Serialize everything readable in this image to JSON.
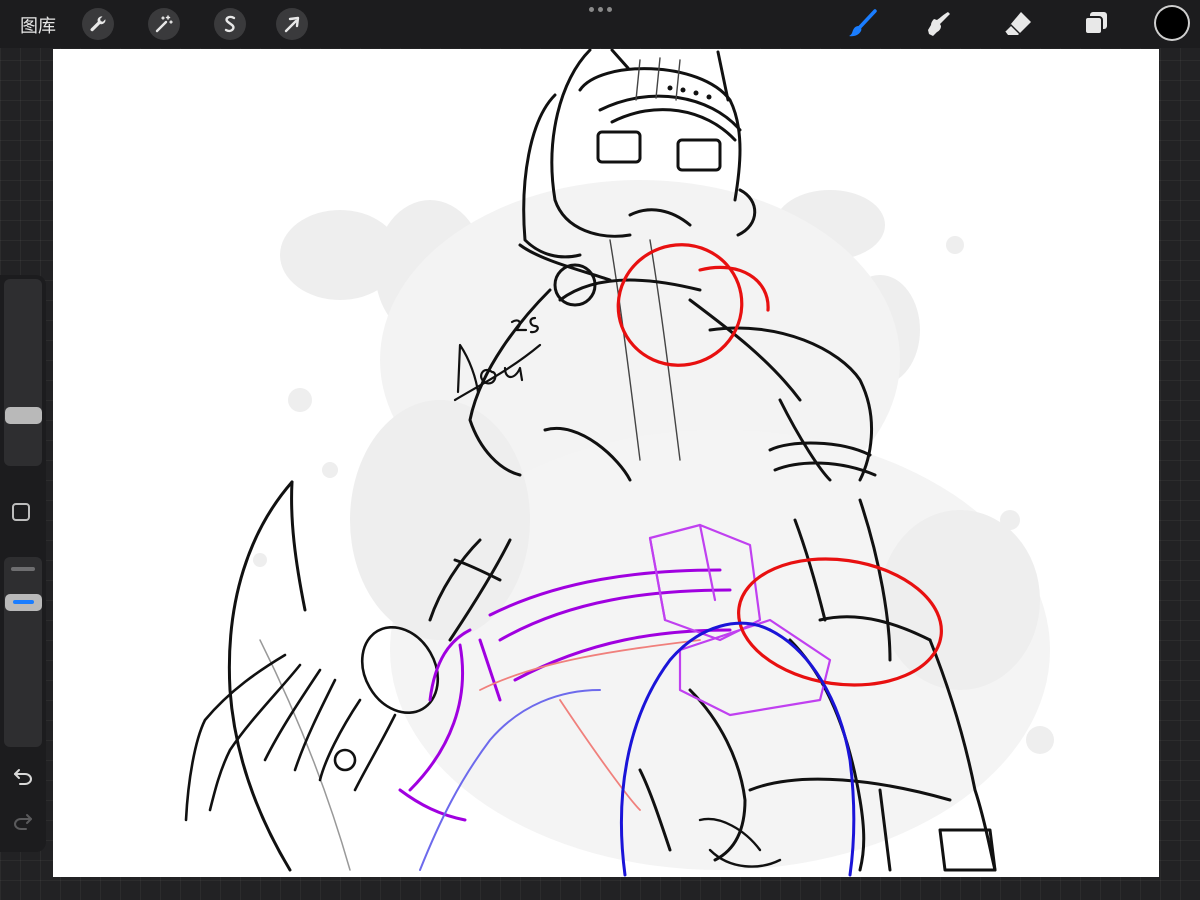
{
  "app": {
    "gallery_label": "图库"
  },
  "toolbar_left": [
    {
      "name": "actions",
      "icon": "wrench-icon"
    },
    {
      "name": "adjustments",
      "icon": "magic-wand-icon"
    },
    {
      "name": "selection",
      "icon": "selection-s-icon"
    },
    {
      "name": "transform",
      "icon": "arrow-cursor-icon"
    }
  ],
  "toolbar_right": [
    {
      "name": "brush",
      "icon": "brush-icon",
      "active": true
    },
    {
      "name": "smudge",
      "icon": "smudge-icon",
      "active": false
    },
    {
      "name": "eraser",
      "icon": "eraser-icon",
      "active": false
    },
    {
      "name": "layers",
      "icon": "layers-icon",
      "active": false
    }
  ],
  "current_color": "#000000",
  "accent": "#1a7dff",
  "artwork": {
    "signature": "Nou 25",
    "stroke_colors": [
      "#000000",
      "#e81010",
      "#a000e0",
      "#1a14d8"
    ]
  }
}
